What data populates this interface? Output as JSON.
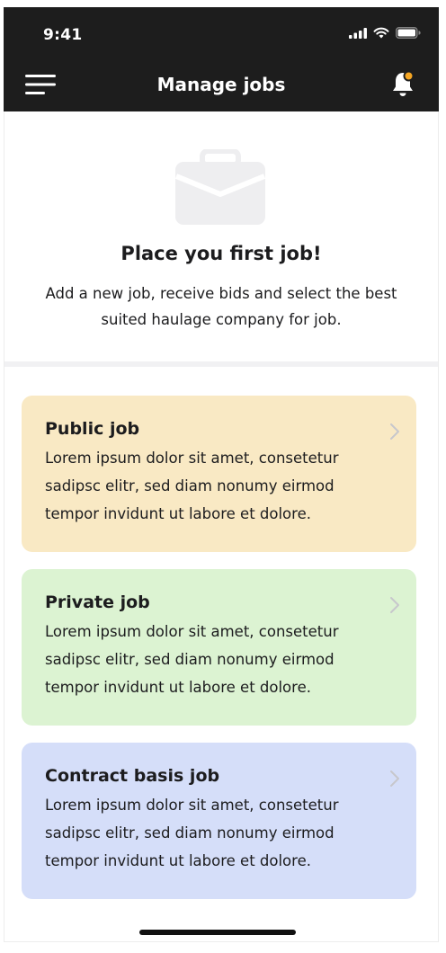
{
  "status_bar": {
    "time": "9:41"
  },
  "nav": {
    "title": "Manage jobs",
    "menu_icon": "hamburger-menu-icon",
    "bell_icon": "notification-bell-icon",
    "bell_dot_color": "#f5a623"
  },
  "hero": {
    "icon": "briefcase-icon",
    "title": "Place you first job!",
    "text": "Add a new job, receive bids and select the best suited haulage company for job."
  },
  "cards": [
    {
      "title": "Public job",
      "text": "Lorem ipsum dolor sit amet, consetetur sadipsc elitr, sed diam nonumy eirmod tempor invidunt ut labore et dolore.",
      "color": "#f9e9c4"
    },
    {
      "title": "Private job",
      "text": "Lorem ipsum dolor sit amet, consetetur sadipsc elitr, sed diam nonumy eirmod tempor invidunt ut labore et dolore.",
      "color": "#dcf3d2"
    },
    {
      "title": "Contract basis job",
      "text": "Lorem ipsum dolor sit amet, consetetur sadipsc elitr, sed diam nonumy eirmod tempor invidunt ut labore et dolore.",
      "color": "#d5def9"
    }
  ]
}
